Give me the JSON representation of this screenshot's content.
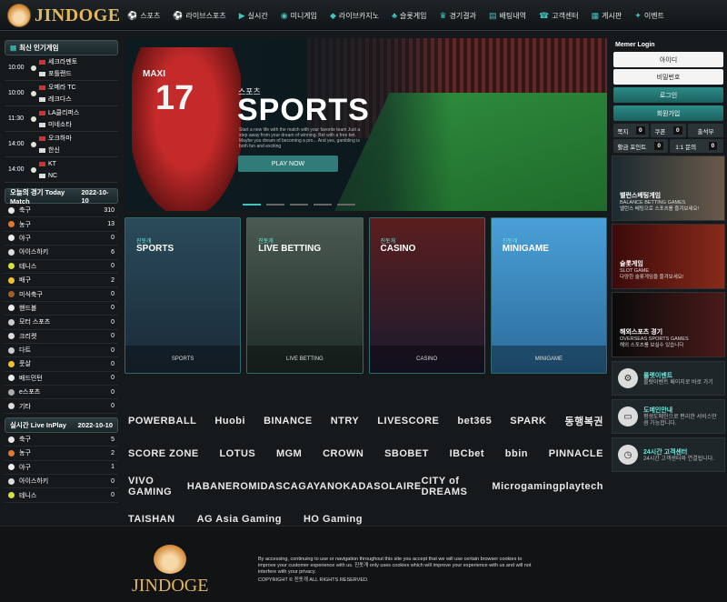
{
  "header": {
    "logo_text": "JINDOGE",
    "nav": [
      {
        "icon": "soccer-icon",
        "label": "스포츠"
      },
      {
        "icon": "soccer-icon",
        "label": "라이브스포츠"
      },
      {
        "icon": "live-icon",
        "label": "실시간"
      },
      {
        "icon": "game-icon",
        "label": "미니게임"
      },
      {
        "icon": "diamond-icon",
        "label": "라이브카지노"
      },
      {
        "icon": "slot-icon",
        "label": "슬롯게임"
      },
      {
        "icon": "trophy-icon",
        "label": "경기결과"
      },
      {
        "icon": "list-icon",
        "label": "배팅내역"
      },
      {
        "icon": "support-icon",
        "label": "고객센터"
      },
      {
        "icon": "board-icon",
        "label": "게시판"
      },
      {
        "icon": "gift-icon",
        "label": "이벤트"
      }
    ]
  },
  "left": {
    "popular_title": "최신 인기게임",
    "matches": [
      {
        "time": "10:00",
        "home": "세크라멘토",
        "away": "포틀랜드"
      },
      {
        "time": "10:00",
        "home": "오메라 TC",
        "away": "레크다스"
      },
      {
        "time": "11:30",
        "home": "LA클리퍼스",
        "away": "미네소타"
      },
      {
        "time": "14:00",
        "home": "오크하마",
        "away": "한신"
      },
      {
        "time": "14:00",
        "home": "KT",
        "away": "NC"
      }
    ],
    "today_title": "오늘의 경기 Today Match",
    "today_date": "2022-10-10",
    "today": [
      {
        "name": "축구",
        "count": "310"
      },
      {
        "name": "농구",
        "count": "13"
      },
      {
        "name": "야구",
        "count": "0"
      },
      {
        "name": "아이스하키",
        "count": "6"
      },
      {
        "name": "테니스",
        "count": "0"
      },
      {
        "name": "배구",
        "count": "2"
      },
      {
        "name": "미식축구",
        "count": "0"
      },
      {
        "name": "핸드볼",
        "count": "0"
      },
      {
        "name": "모터 스포츠",
        "count": "0"
      },
      {
        "name": "크리켓",
        "count": "0"
      },
      {
        "name": "다트",
        "count": "0"
      },
      {
        "name": "풋살",
        "count": "0"
      },
      {
        "name": "배드민턴",
        "count": "0"
      },
      {
        "name": "e스포츠",
        "count": "0"
      },
      {
        "name": "기타",
        "count": "0"
      }
    ],
    "inplay_title": "실시간 Live InPlay",
    "inplay_date": "2022-10-10",
    "inplay": [
      {
        "name": "축구",
        "count": "5"
      },
      {
        "name": "농구",
        "count": "2"
      },
      {
        "name": "야구",
        "count": "1"
      },
      {
        "name": "아이스하키",
        "count": "0"
      },
      {
        "name": "테니스",
        "count": "0"
      }
    ]
  },
  "hero": {
    "number": "17",
    "player_name": "MAXI",
    "sub": "스포츠",
    "title": "SPORTS",
    "desc": "Start a new life with the match with your favorite team Just a step away from your dream of winning. Bet with a free bet. Maybe you dream of becoming a pro... And yes, gambling is both fun and exciting",
    "button": "PLAY NOW"
  },
  "cards": [
    {
      "sub": "진돗개",
      "title": "SPORTS",
      "footer": "SPORTS"
    },
    {
      "sub": "진돗개",
      "title": "LIVE BETTING",
      "footer": "LIVE BETTING"
    },
    {
      "sub": "진돗개",
      "title": "CASINO",
      "footer": "CASINO"
    },
    {
      "sub": "진돗개",
      "title": "MINIGAME",
      "footer": "MINIGAME"
    }
  ],
  "partners": [
    [
      "POWERBALL",
      "Huobi",
      "BINANCE",
      "NTRY",
      "LIVESCORE",
      "bet365",
      "SPARK",
      "동행복권"
    ],
    [
      "SCORE ZONE",
      "LOTUS",
      "MGM",
      "CROWN",
      "SBOBET",
      "IBCbet",
      "bbin",
      "PINNACLE"
    ],
    [
      "VIVO GAMING",
      "HABANERO",
      "MIDAS",
      "CAGAYAN",
      "OKADA",
      "SOLAIRE",
      "CITY of DREAMS",
      "Microgaming",
      "playtech"
    ],
    [
      "TAISHAN",
      "AG Asia Gaming",
      "HO Gaming"
    ]
  ],
  "right": {
    "login_title": "Memer Login",
    "id_placeholder": "아이디",
    "pw_placeholder": "비밀번호",
    "login_btn": "로그인",
    "signup_btn": "회원가입",
    "stats": [
      {
        "label": "쪽지",
        "value": "0"
      },
      {
        "label": "쿠폰",
        "value": "0"
      },
      {
        "label": "출석부",
        "value": ""
      }
    ],
    "stats2": [
      {
        "label": "활금 포인트",
        "value": "0"
      },
      {
        "label": "1:1 문의",
        "value": "0"
      }
    ],
    "banners": [
      {
        "title": "밸런스베팅게임",
        "desc": "BALANCE BETTING GAMES\n밸런스 베팅으로 스포츠를 즐겨보세요!"
      },
      {
        "title": "슬롯게임",
        "desc": "SLOT GAME\n다양한 슬롯게임을 즐겨보세요!"
      },
      {
        "title": "해외스포츠 경기",
        "desc": "OVERSEAS SPORTS GAMES\n해외 스포츠를 보실수 있습니다"
      }
    ],
    "info": [
      {
        "icon": "gear-icon",
        "title": "롤렛이벤트",
        "desc": "룰렛이벤트 페이지로 바로 가기"
      },
      {
        "icon": "monitor-icon",
        "title": "도메인안내",
        "desc": "평생도메인으로 편리한 서비스만큼 가능합니다."
      },
      {
        "icon": "clock-icon",
        "title": "24시간 고객센터",
        "desc": "24시간 고객센터와 연결됩니다."
      }
    ]
  },
  "footer": {
    "logo": "JINDOGE",
    "notice": "By accessing, continuing to use or navigation throughout this site you accept that we will use certain browser cookies to improve your customer experience with us. 진돗개 only uses cookies which will improve your experience with us and will not interfere with your privacy.",
    "copyright": "COPYRIGHT © 진돗개 ALL RIGHTS RESERVED."
  }
}
